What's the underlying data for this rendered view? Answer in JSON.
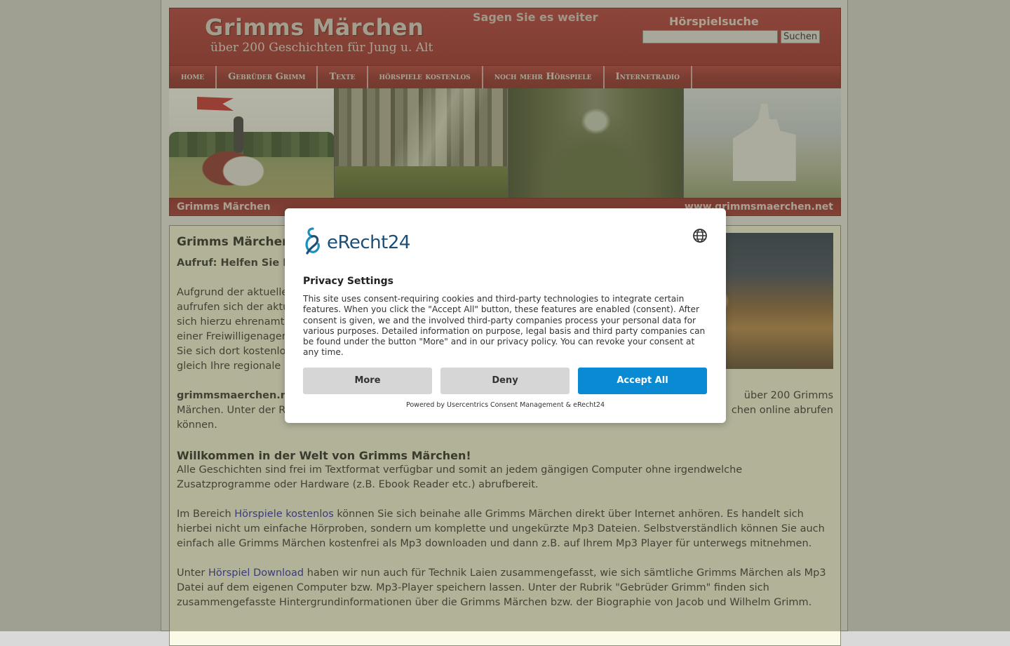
{
  "header": {
    "site_title": "Grimms Märchen",
    "site_subtitle": "über 200 Geschichten für Jung u. Alt",
    "share_text": "Sagen Sie es weiter",
    "search_title": "Hörspielsuche",
    "search_placeholder": "",
    "search_button": "Suchen"
  },
  "nav": {
    "items": [
      {
        "label": "home"
      },
      {
        "label": "Gebrüder Grimm"
      },
      {
        "label": "Texte"
      },
      {
        "label": "hörspiele kostenlos"
      },
      {
        "label": "noch mehr Hörspiele"
      },
      {
        "label": "Internetradio"
      }
    ]
  },
  "banner": {
    "left_text": "Grimms Märchen",
    "right_text": "www.grimmsmaerchen.net"
  },
  "content": {
    "heading": "Grimms Märchen",
    "aufruf": "Aufruf: Helfen Sie F",
    "para1": "Aufgrund der aktuellen\naufrufen sich der aktu\nsich hierzu ehrenamtli\neiner Freiwilligenagent\nSie sich dort kostenlos\ngleich Ihre regionale B",
    "para2_bold": "grimmsmaerchen.ne",
    "para2_rest_right": "über 200 Grimms",
    "para2_line2_left": "Märchen. Unter der Ru",
    "para2_line2_right": "chen online abrufen",
    "para2_line3": "können.",
    "welcome_heading": "Willkommen in der Welt von Grimms Märchen!",
    "para3": "Alle Geschichten sind frei im Textformat verfügbar und somit an jedem gängigen Computer ohne irgendwelche Zusatzprogramme oder Hardware (z.B. Ebook Reader etc.) abrufbereit.",
    "para4_before": "Im Bereich ",
    "para4_link": "Hörspiele kostenlos",
    "para4_after": " können Sie sich beinahe alle Grimms Märchen direkt über Internet anhören. Es handelt sich hierbei nicht um einfache Hörproben, sondern um komplette und ungekürzte Mp3 Dateien. Selbstverständlich können Sie auch einfach alle Grimms Märchen kostenfrei als Mp3 downloaden und dann z.B. auf Ihrem Mp3 Player für unterwegs mitnehmen.",
    "para5_before": "Unter ",
    "para5_link": "Hörspiel Download",
    "para5_after": " haben wir nun auch für Technik Laien zusammengefasst, wie sich sämtliche Grimms Märchen als Mp3 Datei auf dem eigenen Computer bzw. Mp3-Player speichern lassen. Unter der Rubrik \"Gebrüder Grimm\" finden sich zusammengefasste Hintergrundinformationen über die Grimms Märchen bzw. der Biographie von Jacob und Wilhelm Grimm."
  },
  "consent": {
    "logo_text": "eRecht24",
    "title": "Privacy Settings",
    "text": "This site uses consent-requiring cookies and third-party technologies to integrate certain features. When you click the \"Accept All\" button, these features are enabled (consent). After consent is given, we and the involved third-party companies process your personal data for various purposes. Detailed information on purpose, legal basis and third party companies can be found under the button \"More\" and in our privacy policy. You can revoke your consent at any time.",
    "more_label": "More",
    "deny_label": "Deny",
    "accept_label": "Accept All",
    "powered_by": "Powered by Usercentrics Consent Management & eRecht24"
  },
  "colors": {
    "header_red": "#a52a30",
    "content_bg": "#fafae6",
    "accept_blue": "#0b8ad4",
    "link_blue": "#1d24b0"
  },
  "icons": {
    "logo": "erecht24-logo-icon",
    "language": "globe-icon"
  }
}
